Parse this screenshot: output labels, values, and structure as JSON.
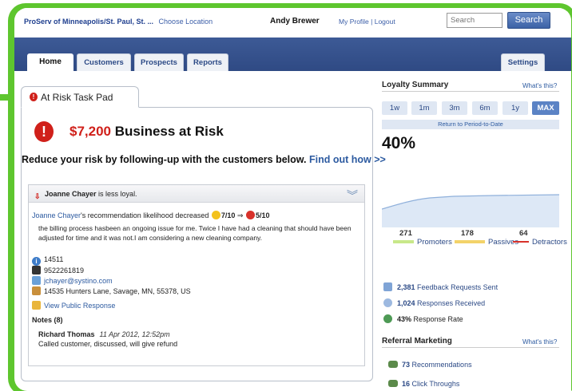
{
  "header": {
    "org_name": "ProServ of Minneapolis/St. Paul, St. ...",
    "choose_location": "Choose Location",
    "user_name": "Andy Brewer",
    "profile_links": "My Profile | Logout",
    "search_placeholder": "Search",
    "search_button": "Search"
  },
  "nav": {
    "tabs": [
      {
        "label": "Home",
        "active": true
      },
      {
        "label": "Customers"
      },
      {
        "label": "Prospects"
      },
      {
        "label": "Reports"
      }
    ],
    "settings_label": "Settings"
  },
  "taskpad": {
    "tab_label": "At Risk Task Pad",
    "amount": "$7,200",
    "title_suffix": "Business at Risk",
    "reduce_text": "Reduce your risk by following-up with the customers below.",
    "find_out": "Find out how >>",
    "customer": {
      "name": "Joanne Chayer",
      "status_suffix": "is less loyal.",
      "rec_name": "Joanne Chayer",
      "rec_text": "'s recommendation likelihood decreased",
      "old_score": "7/10",
      "arrow": "⇒",
      "new_score": "5/10",
      "comment": "the billing process hasbeen an ongoing issue for me. Twice I have had a cleaning that should have been adjusted for time and it was not.I am considering a new cleaning company.",
      "id": "14511",
      "phone": "9522261819",
      "email": "jchayer@systino.com",
      "address": "14535 Hunters Lane, Savage, MN, 55378, US",
      "view_public": "View Public Response",
      "notes_label": "Notes (8)",
      "note_author": "Richard Thomas",
      "note_date": "11 Apr 2012, 12:52pm",
      "note_text": "Called customer, discussed, will give refund"
    }
  },
  "loyalty": {
    "title": "Loyalty Summary",
    "whats_this": "What's this?",
    "periods": [
      "1w",
      "1m",
      "3m",
      "6m",
      "1y",
      "MAX"
    ],
    "active_period": "MAX",
    "return_label": "Return to Period-to-Date",
    "score": "40%",
    "promoters_count": "271",
    "promoters_label": "Promoters",
    "passives_count": "178",
    "passives_label": "Passives",
    "detractors_count": "64",
    "detractors_label": "Detractors",
    "promoter_color": "#c8e88a",
    "passive_color": "#f3d36a",
    "detractor_color": "#d8322b",
    "feedback_num": "2,381",
    "feedback_label": "Feedback Requests Sent",
    "responses_num": "1,024",
    "responses_label": "Responses Received",
    "rate_num": "43%",
    "rate_label": "Response Rate"
  },
  "referral": {
    "title": "Referral Marketing",
    "whats_this": "What's this?",
    "recommendations_num": "73",
    "recommendations_label": "Recommendations",
    "clicks_num": "16",
    "clicks_label": "Click Throughs"
  }
}
